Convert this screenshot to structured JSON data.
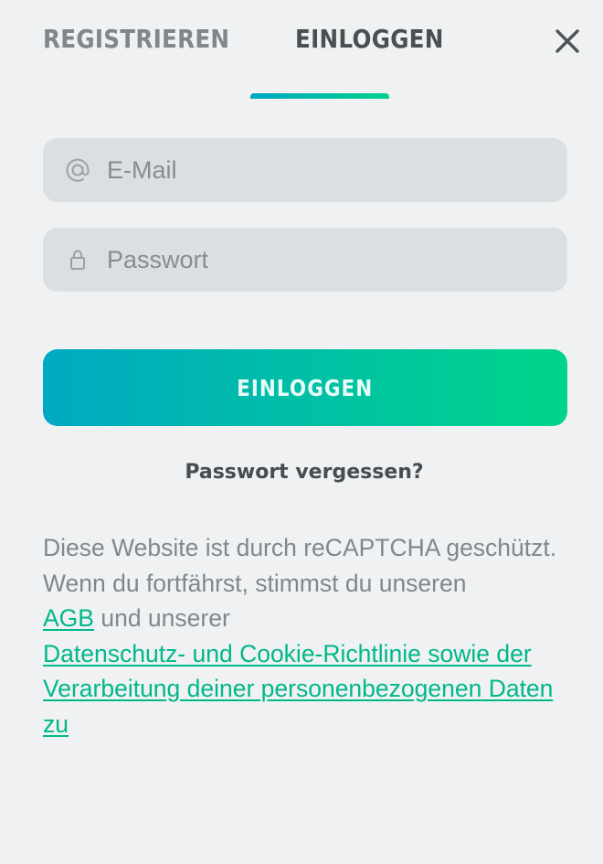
{
  "tabs": {
    "register": "REGISTRIEREN",
    "login": "EINLOGGEN"
  },
  "close": {
    "icon": "close-icon"
  },
  "form": {
    "email_placeholder": "E-Mail",
    "email_icon": "at-icon",
    "password_placeholder": "Passwort",
    "password_icon": "lock-icon",
    "submit_label": "EINLOGGEN",
    "forgot_label": "Passwort vergessen?"
  },
  "legal": {
    "line1": "Diese Website ist durch reCAPTCHA geschützt.",
    "line2_prefix": "Wenn du fortfährst, stimmst du unseren",
    "agb_link": "AGB",
    "middle": "und unserer",
    "privacy_link": "Datenschutz- und Cookie-Richtlinie sowie der Verarbeitung deiner personenbezogenen Daten zu"
  },
  "colors": {
    "accent_start": "#00a9c2",
    "accent_end": "#00d58a",
    "link": "#00b88a",
    "background": "#f0f1f3"
  }
}
